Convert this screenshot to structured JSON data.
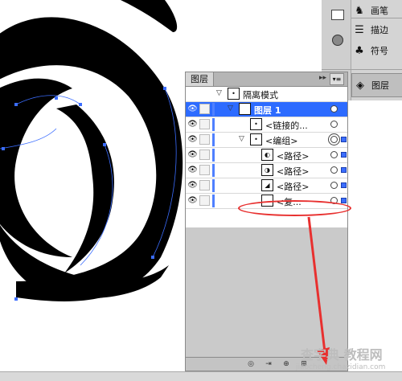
{
  "dock": {
    "items": [
      {
        "label": "画笔",
        "icon": "brush-icon",
        "glyph": "♞"
      },
      {
        "label": "描边",
        "icon": "stroke-icon",
        "glyph": "☰"
      },
      {
        "label": "符号",
        "icon": "symbol-icon",
        "glyph": "♣"
      },
      {
        "label": "图层",
        "icon": "layers-icon",
        "glyph": "◈"
      }
    ]
  },
  "panel": {
    "title": "图层",
    "collapse_glyph": "▸▸",
    "menu_glyph": "▾≡"
  },
  "layers": [
    {
      "name": "隔离模式",
      "indent": 0,
      "expander": "▽",
      "active": false,
      "has_target": false,
      "selected": false,
      "thumb": "•"
    },
    {
      "name": "图层 1",
      "indent": 1,
      "expander": "▽",
      "active": true,
      "has_target": true,
      "selected": false,
      "thumb": "•"
    },
    {
      "name": "<链接的...",
      "indent": 2,
      "expander": "",
      "active": false,
      "has_target": true,
      "selected": false,
      "thumb": "•"
    },
    {
      "name": "<编组>",
      "indent": 2,
      "expander": "▽",
      "active": false,
      "has_target": true,
      "selected": true,
      "thumb": "•"
    },
    {
      "name": "<路径>",
      "indent": 3,
      "expander": "",
      "active": false,
      "has_target": true,
      "selected": true,
      "thumb": "◐"
    },
    {
      "name": "<路径>",
      "indent": 3,
      "expander": "",
      "active": false,
      "has_target": true,
      "selected": true,
      "thumb": "◑"
    },
    {
      "name": "<路径>",
      "indent": 3,
      "expander": "",
      "active": false,
      "has_target": true,
      "selected": true,
      "thumb": "◢"
    },
    {
      "name": "<复...",
      "indent": 3,
      "expander": "",
      "active": false,
      "has_target": true,
      "selected": true,
      "thumb": ""
    }
  ],
  "footer": {
    "buttons": [
      "◎",
      "⇥",
      "⊕",
      "⊞"
    ]
  },
  "watermark": {
    "text": "查字典 教程网",
    "url": "jiaocheng.chazidian.com"
  },
  "colors": {
    "selection": "#2d6bff",
    "annotation": "#e8302f"
  }
}
